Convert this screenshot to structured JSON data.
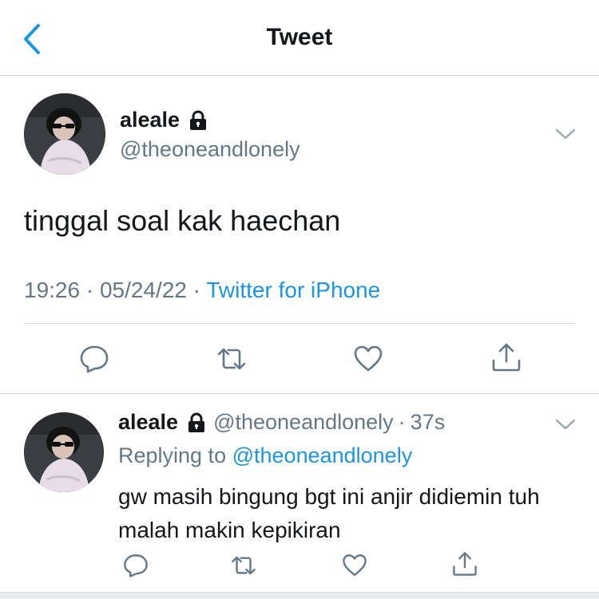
{
  "nav": {
    "title": "Tweet"
  },
  "tweet": {
    "display_name": "aleale",
    "handle": "@theoneandlonely",
    "text": "tinggal soal kak haechan",
    "time": "19:26",
    "date": "05/24/22",
    "separator": "·",
    "source": "Twitter for iPhone"
  },
  "reply": {
    "display_name": "aleale",
    "handle": "@theoneandlonely",
    "separator": "·",
    "age": "37s",
    "replying_label": "Replying to",
    "replying_to": "@theoneandlonely",
    "text": "gw masih bingung bgt ini anjir didiemin tuh malah makin kepikiran"
  },
  "icons": {
    "back": "chevron-left-icon",
    "lock": "lock-icon",
    "more": "chevron-down-icon",
    "reply": "reply-icon",
    "retweet": "retweet-icon",
    "like": "heart-icon",
    "share": "share-icon"
  },
  "colors": {
    "accent": "#1b95e0",
    "secondary_text": "#657786",
    "primary_text": "#14171a",
    "divider": "#d8dde1"
  }
}
